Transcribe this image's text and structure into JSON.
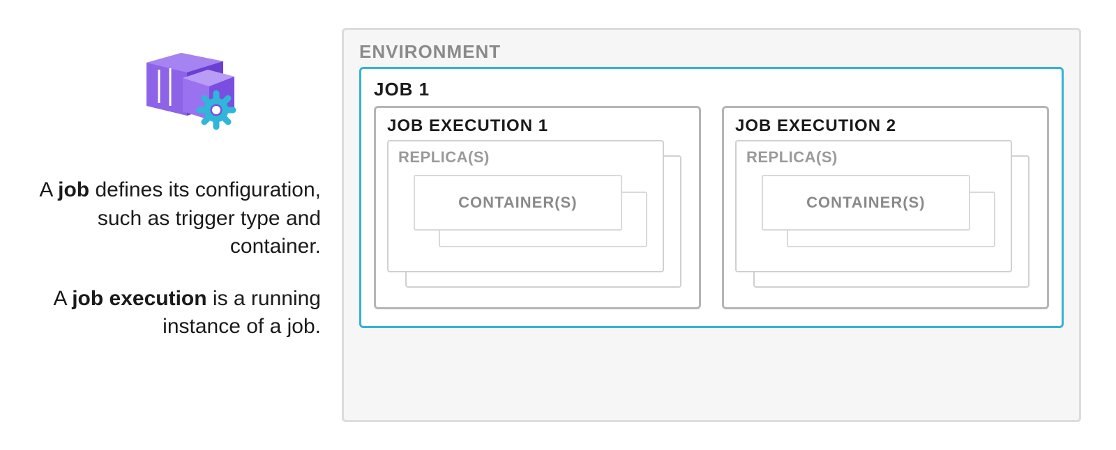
{
  "left": {
    "p1_prefix": "A ",
    "p1_bold": "job",
    "p1_suffix": " defines its configuration, such as trigger type and container.",
    "p2_prefix": "A ",
    "p2_bold": "job execution",
    "p2_suffix": " is a running instance of a job."
  },
  "diagram": {
    "environment_label": "ENVIRONMENT",
    "job_label": "JOB 1",
    "executions": [
      {
        "label": "JOB EXECUTION 1",
        "replica_label": "REPLICA(S)",
        "container_label": "CONTAINER(S)"
      },
      {
        "label": "JOB EXECUTION 2",
        "replica_label": "REPLICA(S)",
        "container_label": "CONTAINER(S)"
      }
    ]
  },
  "colors": {
    "accent": "#33b3d6",
    "purple": "#7b4fd1",
    "purple_dark": "#5a33a8",
    "grey": "#b5b5b5"
  }
}
